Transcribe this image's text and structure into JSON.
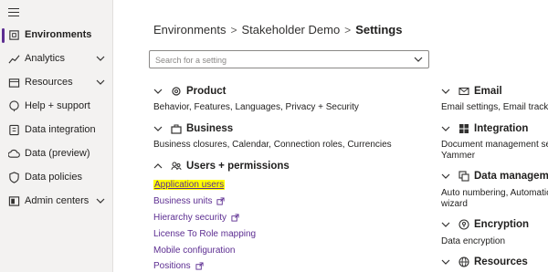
{
  "sidebar": {
    "items": [
      {
        "label": "Environments",
        "icon": "environments-icon",
        "active": true,
        "chevron": false
      },
      {
        "label": "Analytics",
        "icon": "analytics-icon",
        "active": false,
        "chevron": true
      },
      {
        "label": "Resources",
        "icon": "resources-icon",
        "active": false,
        "chevron": true
      },
      {
        "label": "Help + support",
        "icon": "help-icon",
        "active": false,
        "chevron": false
      },
      {
        "label": "Data integration",
        "icon": "data-integration-icon",
        "active": false,
        "chevron": false
      },
      {
        "label": "Data (preview)",
        "icon": "cloud-icon",
        "active": false,
        "chevron": false
      },
      {
        "label": "Data policies",
        "icon": "shield-icon",
        "active": false,
        "chevron": false
      },
      {
        "label": "Admin centers",
        "icon": "admin-centers-icon",
        "active": false,
        "chevron": true
      }
    ]
  },
  "breadcrumb": {
    "root": "Environments",
    "env": "Stakeholder Demo",
    "current": "Settings"
  },
  "search": {
    "placeholder": "Search for a setting"
  },
  "sections_left": {
    "product": {
      "title": "Product",
      "desc": "Behavior, Features, Languages, Privacy + Security"
    },
    "business": {
      "title": "Business",
      "desc": "Business closures, Calendar, Connection roles, Currencies"
    },
    "users": {
      "title": "Users + permissions"
    }
  },
  "user_links": [
    {
      "label": "Application users",
      "external": false,
      "highlight": true
    },
    {
      "label": "Business units",
      "external": true,
      "highlight": false
    },
    {
      "label": "Hierarchy security",
      "external": true,
      "highlight": false
    },
    {
      "label": "License To Role mapping",
      "external": false,
      "highlight": false
    },
    {
      "label": "Mobile configuration",
      "external": false,
      "highlight": false
    },
    {
      "label": "Positions",
      "external": true,
      "highlight": false
    }
  ],
  "sections_right": {
    "email": {
      "title": "Email",
      "desc": "Email settings, Email tracking, M"
    },
    "integration": {
      "title": "Integration",
      "desc": "Document management setting",
      "desc2": "Yammer"
    },
    "data_management": {
      "title": "Data management",
      "desc": "Auto numbering, Automatic re",
      "desc2": "wizard"
    },
    "encryption": {
      "title": "Encryption",
      "desc": "Data encryption"
    },
    "resources": {
      "title": "Resources"
    }
  },
  "colors": {
    "accent": "#5c2d91",
    "highlight": "#ffff00",
    "sidebar_bg": "#f3f2f1"
  }
}
